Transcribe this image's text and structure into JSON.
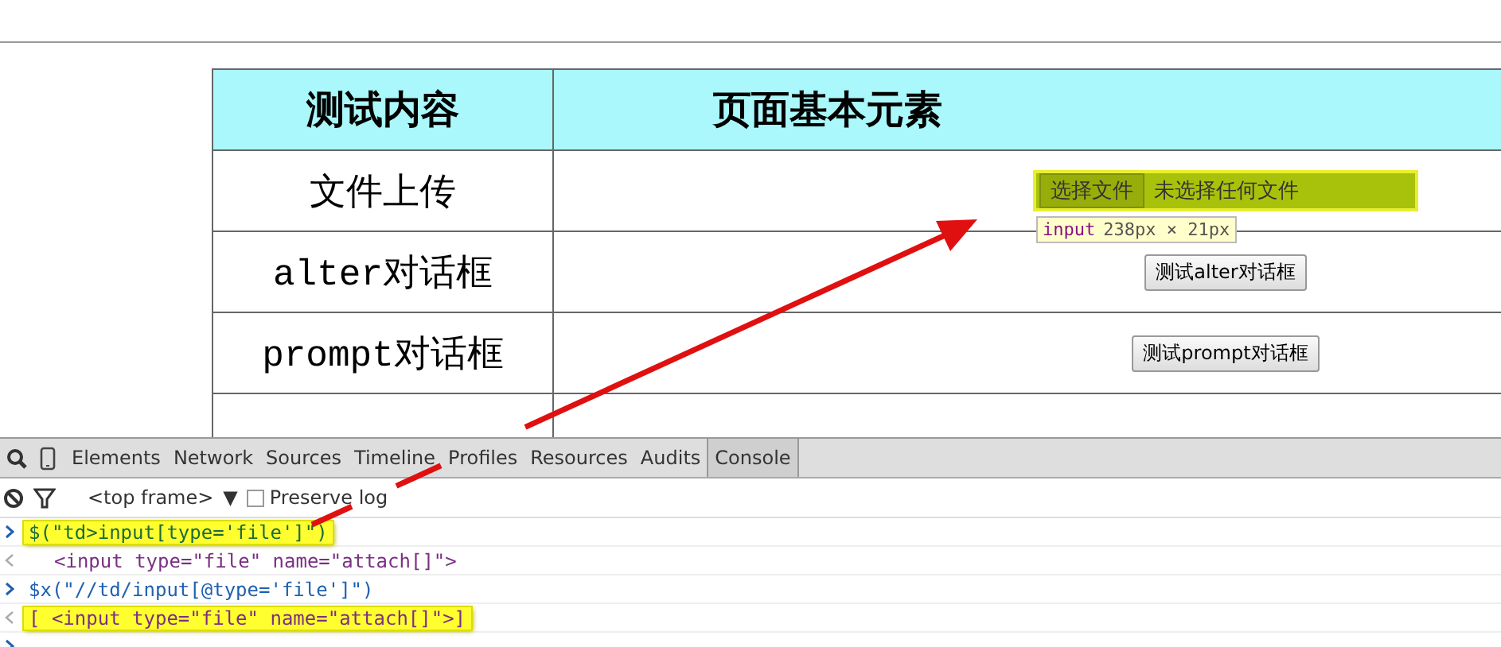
{
  "table": {
    "columns": [
      "测试内容",
      "页面基本元素"
    ],
    "rows": [
      {
        "label": "文件上传",
        "control": {
          "kind": "file",
          "button": "选择文件",
          "status": "未选择任何文件",
          "highlighted": true
        }
      },
      {
        "label": "alter对话框",
        "control": {
          "kind": "button",
          "text": "测试alter对话框"
        }
      },
      {
        "label": "prompt对话框",
        "control": {
          "kind": "button",
          "text": "测试prompt对话框"
        }
      }
    ]
  },
  "tooltip": {
    "tag": "input",
    "size": "238px × 21px"
  },
  "devtools": {
    "tabs": [
      {
        "label": "Elements",
        "selected": false
      },
      {
        "label": "Network",
        "selected": false
      },
      {
        "label": "Sources",
        "selected": false
      },
      {
        "label": "Timeline",
        "selected": false
      },
      {
        "label": "Profiles",
        "selected": false
      },
      {
        "label": "Resources",
        "selected": false
      },
      {
        "label": "Audits",
        "selected": false
      },
      {
        "label": "Console",
        "selected": true
      }
    ],
    "frame": "<top frame>",
    "frame_caret": "▼",
    "preserve_log": {
      "label": "Preserve log",
      "checked": false
    },
    "console": [
      {
        "kind": "input",
        "text": "$(\"td>input[type='file']\")",
        "highlighted": true
      },
      {
        "kind": "output",
        "text": "<input type=\"file\" name=\"attach[]\">",
        "highlighted": false
      },
      {
        "kind": "input",
        "text": "$x(\"//td/input[@type='file']\")",
        "highlighted": false
      },
      {
        "kind": "output",
        "text": "[ <input type=\"file\" name=\"attach[]\">]",
        "highlighted": true
      },
      {
        "kind": "prompt"
      }
    ]
  }
}
